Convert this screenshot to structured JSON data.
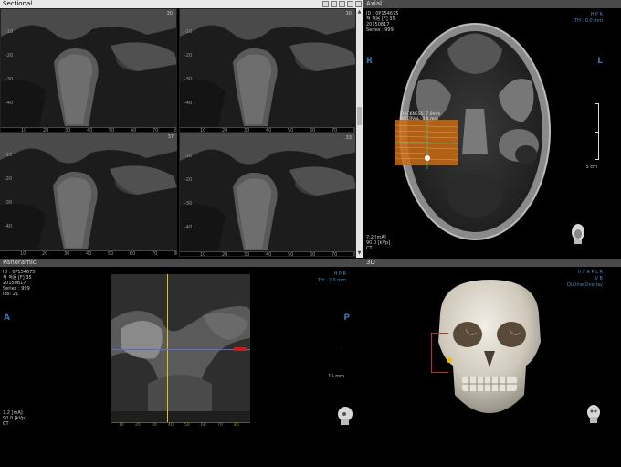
{
  "sectional": {
    "title": "Sectional",
    "views": [
      {
        "index": "30",
        "ticks_left": [
          "-10",
          "-20",
          "-30",
          "-40"
        ],
        "ticks_bottom": [
          "10",
          "20",
          "30",
          "40",
          "50",
          "60",
          "70",
          "80"
        ]
      },
      {
        "index": "30",
        "ticks_left": [
          "-10",
          "-20",
          "-30",
          "-40"
        ],
        "ticks_bottom": [
          "10",
          "20",
          "30",
          "40",
          "50",
          "60",
          "70",
          "80"
        ]
      },
      {
        "index": "37",
        "ticks_left": [
          "-10",
          "-20",
          "-30",
          "-40"
        ],
        "ticks_bottom": [
          "10",
          "20",
          "30",
          "40",
          "50",
          "60",
          "70",
          "80"
        ]
      },
      {
        "index": "33",
        "ticks_left": [
          "-10",
          "-20",
          "-30",
          "-40"
        ],
        "ticks_bottom": [
          "10",
          "20",
          "30",
          "40",
          "50",
          "60",
          "70",
          "80"
        ]
      }
    ],
    "scroll_up": "▲",
    "scroll_down": "▼"
  },
  "axial": {
    "title": "Axial",
    "id_line": "ID : 0P154675",
    "name_line": "적 적용 [F] 35",
    "date_line": "20150817",
    "series_line": "Series : 999",
    "orient_top": "H P R",
    "thickness": "TH : 0.0 mm",
    "left_marker": "R",
    "right_marker": "L",
    "scale": "5 cm",
    "overlay_thickness": "THICKNESS: 7.0mm",
    "overlay_interval": "INTERVAL: 0.5 mm",
    "ma": "7.2 [mA]",
    "kvp": "90.0 [kVp]",
    "modality": "CT"
  },
  "panoramic": {
    "title": "Panoramic",
    "id_line": "ID : 0P154675",
    "name_line": "적 적용 [F] 35",
    "date_line": "20150817",
    "series_line": "Series : 999",
    "idx_line": "Idx: 21",
    "orient_top": "H P R",
    "thickness": "TH : 2.0 mm",
    "left_marker": "A",
    "right_marker": "P",
    "scale": "15 mm",
    "bottom_ticks": [
      "10",
      "20",
      "30",
      "40",
      "50",
      "60",
      "70",
      "80"
    ],
    "ma": "7.2 [mA]",
    "kvp": "90.0 [kVp]",
    "modality": "CT"
  },
  "volume3d": {
    "title": "3D",
    "orient_top": "H F A P L R",
    "orient_sub": "V B",
    "mode": "Outline Overlay"
  }
}
